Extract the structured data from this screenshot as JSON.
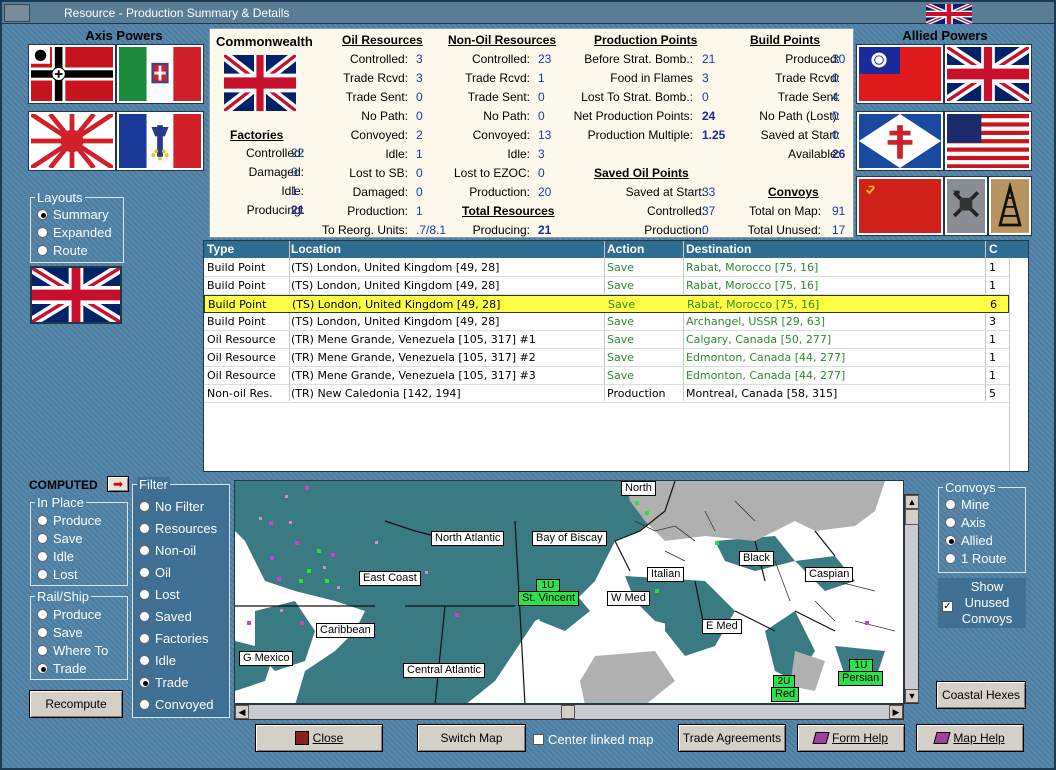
{
  "window": {
    "title": "Resource - Production Summary & Details"
  },
  "left": {
    "axis_title": "Axis Powers",
    "layouts": {
      "title": "Layouts",
      "options": [
        {
          "label": "Summary",
          "selected": true
        },
        {
          "label": "Expanded",
          "selected": false
        },
        {
          "label": "Route",
          "selected": false
        }
      ]
    }
  },
  "right": {
    "allied_title": "Allied Powers"
  },
  "summary": {
    "nation": "Commonwealth",
    "factories": {
      "title": "Factories",
      "rows": [
        {
          "label": "Controlled:",
          "value": "22"
        },
        {
          "label": "Damaged:",
          "value": "0"
        },
        {
          "label": "Idle:",
          "value": "1"
        },
        {
          "label": "Producing:",
          "value": "21"
        }
      ]
    },
    "oil": {
      "title": "Oil Resources",
      "rows": [
        {
          "label": "Controlled:",
          "value": "3"
        },
        {
          "label": "Trade Rcvd:",
          "value": "3"
        },
        {
          "label": "Trade Sent:",
          "value": "0"
        },
        {
          "label": "No Path:",
          "value": "0"
        },
        {
          "label": "Convoyed:",
          "value": "2"
        },
        {
          "label": "Idle:",
          "value": "1"
        },
        {
          "label": "Lost to SB:",
          "value": "0"
        },
        {
          "label": "Damaged:",
          "value": "0"
        },
        {
          "label": "Production:",
          "value": "1"
        },
        {
          "label": "To Reorg. Units:",
          "value": ".7/8.1"
        }
      ]
    },
    "nonoil": {
      "title": "Non-Oil Resources",
      "rows": [
        {
          "label": "Controlled:",
          "value": "23"
        },
        {
          "label": "Trade Rcvd:",
          "value": "1"
        },
        {
          "label": "Trade Sent:",
          "value": "0"
        },
        {
          "label": "No Path:",
          "value": "0"
        },
        {
          "label": "Convoyed:",
          "value": "13"
        },
        {
          "label": "Idle:",
          "value": "3"
        },
        {
          "label": "Lost to EZOC:",
          "value": "0"
        },
        {
          "label": "Production:",
          "value": "20"
        }
      ]
    },
    "total": {
      "title": "Total Resources",
      "label": "Producing:",
      "value": "21"
    },
    "pp": {
      "title": "Production Points",
      "rows": [
        {
          "label": "Before Strat. Bomb.:",
          "value": "21"
        },
        {
          "label": "Food in Flames",
          "value": "3"
        },
        {
          "label": "Lost To Strat. Bomb.:",
          "value": "0"
        },
        {
          "label": "Net Production Points:",
          "value": "24"
        },
        {
          "label": "Production Multiple:",
          "value": "1.25"
        }
      ]
    },
    "saved_oil": {
      "title": "Saved Oil Points",
      "rows": [
        {
          "label": "Saved at Start:",
          "value": "33"
        },
        {
          "label": "Controlled:",
          "value": "37"
        },
        {
          "label": "Production:",
          "value": "0"
        }
      ]
    },
    "bp": {
      "title": "Build Points",
      "rows": [
        {
          "label": "Produced:",
          "value": "30"
        },
        {
          "label": "Trade Rcvd:",
          "value": "0"
        },
        {
          "label": "Trade Sent:",
          "value": "4"
        },
        {
          "label": "No Path (Lost):",
          "value": "0"
        },
        {
          "label": "Saved at Start:",
          "value": "0"
        },
        {
          "label": "Available:",
          "value": "26"
        }
      ]
    },
    "convoys": {
      "title": "Convoys",
      "rows": [
        {
          "label": "Total on Map:",
          "value": "91"
        },
        {
          "label": "Total Unused:",
          "value": "17"
        }
      ]
    }
  },
  "table": {
    "headers": [
      "Type",
      "Location",
      "Action",
      "Destination",
      "C"
    ],
    "rows": [
      [
        "Build Point",
        "(TS) London, United Kingdom [49, 28]",
        "Save",
        "Rabat, Morocco [75, 16]",
        "1"
      ],
      [
        "Build Point",
        "(TS) London, United Kingdom [49, 28]",
        "Save",
        "Rabat, Morocco [75, 16]",
        "1"
      ],
      [
        "Build Point",
        "(TS) London, United Kingdom [49, 28]",
        "Save",
        "Rabat, Morocco [75, 16]",
        "6"
      ],
      [
        "Build Point",
        "(TS) London, United Kingdom [49, 28]",
        "Save",
        "Archangel, USSR [29, 63]",
        "3"
      ],
      [
        "Oil Resource",
        "(TR) Mene Grande, Venezuela [105, 317] #1",
        "Save",
        "Calgary, Canada [50, 277]",
        "1"
      ],
      [
        "Oil Resource",
        "(TR) Mene Grande, Venezuela [105, 317] #2",
        "Save",
        "Edmonton, Canada [44, 277]",
        "1"
      ],
      [
        "Oil Resource",
        "(TR) Mene Grande, Venezuela [105, 317] #3",
        "Save",
        "Edmonton, Canada [44, 277]",
        "1"
      ],
      [
        "Non-oil Res.",
        "(TR) New Caledonia [142, 194]",
        "Production",
        "Montreal, Canada [58, 315]",
        "5"
      ]
    ],
    "selected_row": 2
  },
  "bottom_left": {
    "computed": "COMPUTED",
    "in_place": {
      "title": "In Place",
      "options": [
        "Produce",
        "Save",
        "Idle",
        "Lost"
      ]
    },
    "rail_ship": {
      "title": "Rail/Ship",
      "options": [
        "Produce",
        "Save",
        "Where To",
        "Trade"
      ],
      "selected": "Trade"
    },
    "recompute": "Recompute"
  },
  "filter": {
    "title": "Filter",
    "options": [
      "No Filter",
      "Resources",
      "Non-oil",
      "Oil",
      "Lost",
      "Saved",
      "Factories",
      "Idle",
      "Trade",
      "Convoyed"
    ],
    "selected": "Trade"
  },
  "map": {
    "labels": [
      "North",
      "North Atlantic",
      "Bay of Biscay",
      "Black",
      "Caspian",
      "East Coast",
      "Italian",
      "St. Vincent",
      "W Med",
      "Caribbean",
      "E Med",
      "G Mexico",
      "Central Atlantic",
      "Persian",
      "Red"
    ],
    "units": [
      {
        "text": "1U"
      },
      {
        "text": "2U"
      },
      {
        "text": "1U"
      }
    ]
  },
  "convoys_panel": {
    "title": "Convoys",
    "options": [
      "Mine",
      "Axis",
      "Allied",
      "1 Route"
    ],
    "selected": "Allied",
    "show_unused": "Show Unused Convoys",
    "coastal": "Coastal Hexes"
  },
  "buttons": {
    "close": "Close",
    "switch_map": "Switch Map",
    "center_linked": "Center linked map",
    "trade": "Trade Agreements",
    "form_help": "Form Help",
    "map_help": "Map Help"
  }
}
